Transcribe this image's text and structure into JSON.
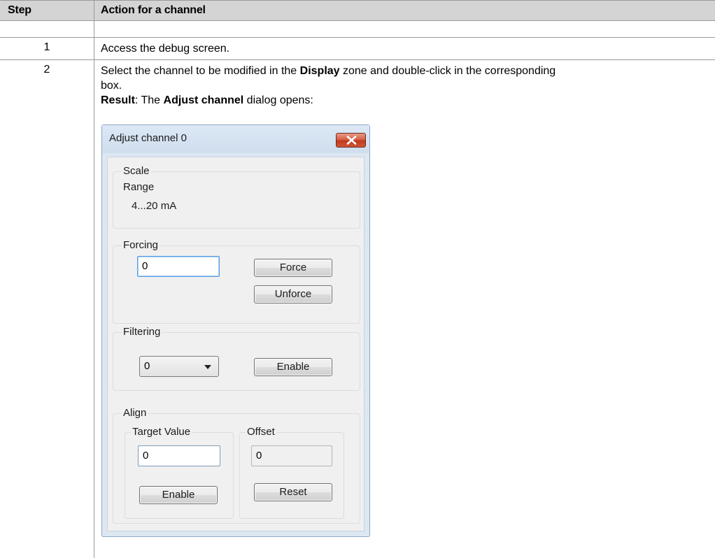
{
  "table": {
    "headers": {
      "step": "Step",
      "action": "Action for a channel"
    },
    "rows": [
      {
        "step": "1",
        "text": "Access the debug screen."
      },
      {
        "step": "2",
        "line1_pre": "Select the channel to be modified in the ",
        "line1_bold": "Display",
        "line1_post": " zone and double-click in the corresponding",
        "line2": "box.",
        "result_bold": "Result",
        "result_mid": ": The ",
        "result_bold2": "Adjust channel",
        "result_post": " dialog opens:"
      }
    ]
  },
  "dialog": {
    "title": "Adjust channel 0",
    "close_icon": "close-x",
    "colors": {
      "close_button": "#c8432a",
      "frame": "#dde7f2",
      "client": "#f0f0f0"
    },
    "scale": {
      "group_label": "Scale",
      "range_label": "Range",
      "range_value": "4...20 mA"
    },
    "forcing": {
      "group_label": "Forcing",
      "value": "0",
      "force_label": "Force",
      "unforce_label": "Unforce"
    },
    "filtering": {
      "group_label": "Filtering",
      "selected": "0",
      "enable_label": "Enable"
    },
    "align": {
      "group_label": "Align",
      "target_label": "Target Value",
      "target_value": "0",
      "target_enable_label": "Enable",
      "offset_label": "Offset",
      "offset_value": "0",
      "reset_label": "Reset"
    }
  }
}
